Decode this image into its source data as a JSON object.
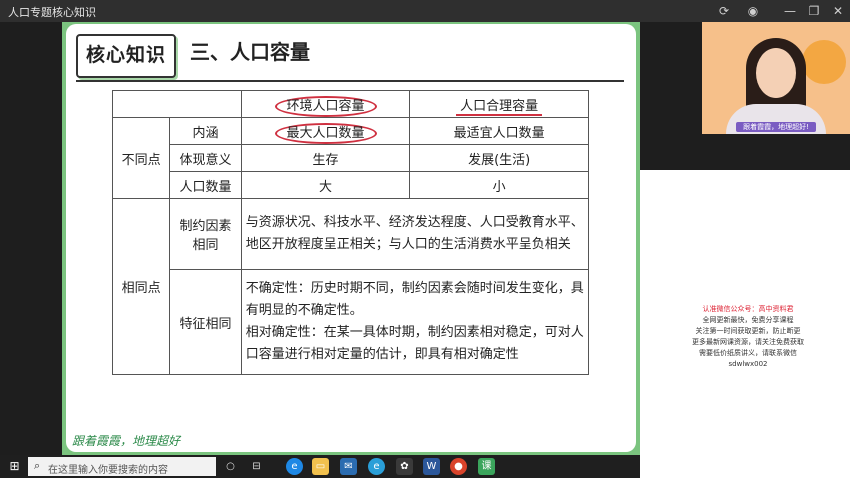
{
  "window": {
    "title": "人口专题核心知识",
    "controls": [
      "refresh-icon",
      "eye-icon",
      "minimize-icon",
      "restore-icon",
      "close-icon"
    ]
  },
  "slide": {
    "badge": "核心知识",
    "heading": "三、人口容量",
    "footer": "跟着霞霞，地理超好",
    "table": {
      "col_headers": [
        "环境人口容量",
        "人口合理容量"
      ],
      "groups": [
        {
          "label": "不同点",
          "rows": [
            {
              "label": "内涵",
              "a": "最大人口数量",
              "b": "最适宜人口数量"
            },
            {
              "label": "体现意义",
              "a": "生存",
              "b": "发展(生活)"
            },
            {
              "label": "人口数量",
              "a": "大",
              "b": "小"
            }
          ]
        },
        {
          "label": "相同点",
          "rows": [
            {
              "label": "制约因素相同",
              "text": "与资源状况、科技水平、经济发达程度、人口受教育水平、地区开放程度呈正相关；与人口的生活消费水平呈负相关"
            },
            {
              "label": "特征相同",
              "text1": "不确定性：历史时期不同，制约因素会随时间发生变化，具有明显的不确定性。",
              "text2": "相对确定性：在某一具体时期，制约因素相对稳定，可对人口容量进行相对定量的估计，即具有相对确定性"
            }
          ]
        }
      ]
    }
  },
  "webcam": {
    "caption": "跟着霞霞，地理超好!"
  },
  "promo": {
    "line1": "认准微信公众号：高中资料君",
    "line2": "全网更新最快，免费分享课程",
    "line3": "关注第一时间获取更新，防止断更",
    "line4": "更多最新网课资源，请关注免费获取",
    "line5": "需要低价纸质讲义，请联系微信sdwlwx002"
  },
  "taskbar": {
    "search_placeholder": "在这里输入你要搜索的内容",
    "colors": {
      "edge": "#1e88e5",
      "folder": "#f2c14e",
      "mail": "#2b6cb0",
      "word": "#2b579a",
      "green": "#3ba55c",
      "red": "#d9442b"
    }
  }
}
